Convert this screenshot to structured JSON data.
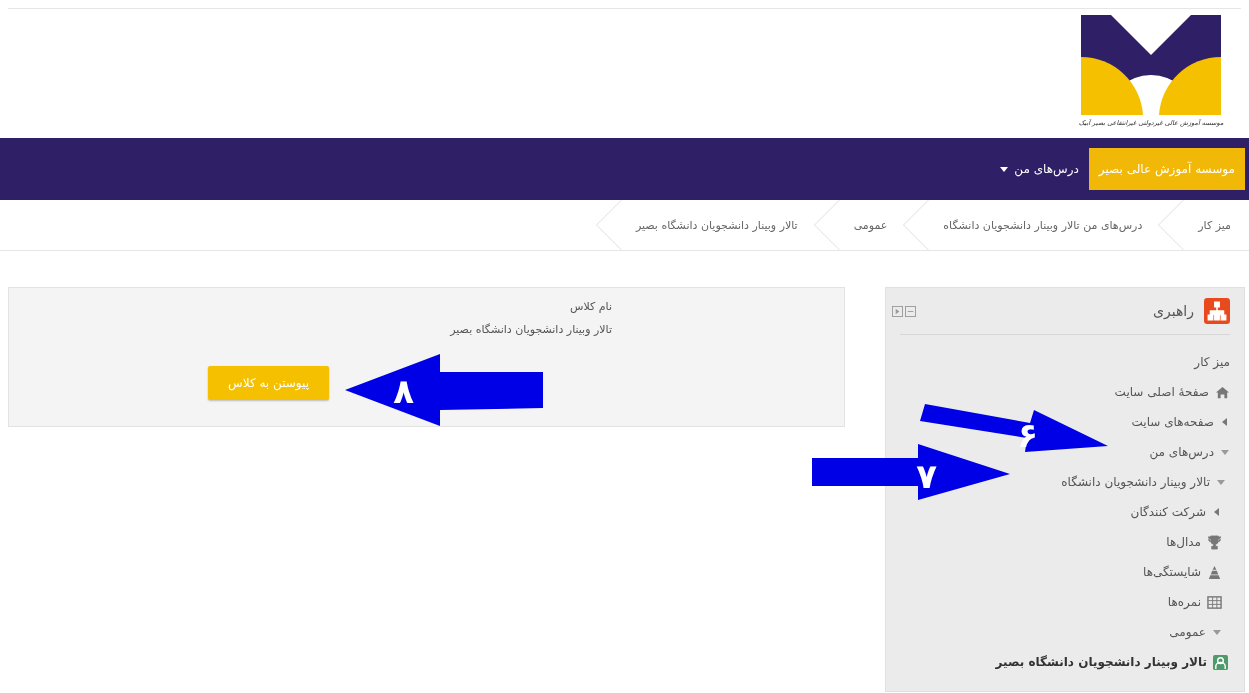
{
  "logo": {
    "caption": "موسسه آموزش عالی غیردولتی غیرانتفاعی بصیر آبیک"
  },
  "navbar": {
    "items": [
      {
        "label": "موسسه آموزش عالی بصیر",
        "selected": true,
        "dropdown": false
      },
      {
        "label": "درس‌های من",
        "selected": false,
        "dropdown": true
      }
    ]
  },
  "breadcrumb": [
    "میز کار",
    "درس‌های من تالار وبینار دانشجویان دانشگاه",
    "عمومی",
    "تالار وبینار دانشجویان دانشگاه بصیر"
  ],
  "navigation_block": {
    "title": "راهبری",
    "tree": [
      {
        "label": "میز کار",
        "kind": "text"
      },
      {
        "label": "صفحهٔ اصلی سایت",
        "kind": "home"
      },
      {
        "label": "صفحه‌های سایت",
        "kind": "branch",
        "expanded": false
      },
      {
        "label": "درس‌های من",
        "kind": "branch",
        "expanded": true,
        "children": [
          {
            "label": "تالار وبینار دانشجویان دانشگاه",
            "kind": "branch",
            "expanded": true,
            "children": [
              {
                "label": "شرکت کنندگان",
                "kind": "branch",
                "expanded": false
              },
              {
                "label": "مدال‌ها",
                "kind": "trophy"
              },
              {
                "label": "شایستگی‌ها",
                "kind": "competency"
              },
              {
                "label": "نمره‌ها",
                "kind": "grades"
              },
              {
                "label": "عمومی",
                "kind": "branch",
                "expanded": true,
                "children": [
                  {
                    "label": "تالار وبینار دانشجویان دانشگاه بصیر",
                    "kind": "activity"
                  }
                ]
              }
            ]
          }
        ]
      }
    ]
  },
  "class_panel": {
    "heading": "نام کلاس",
    "name": "تالار وبینار دانشجویان دانشگاه بصیر",
    "button": "پیوستن به کلاس"
  },
  "annotations": [
    {
      "label": "۸"
    },
    {
      "label": "۶"
    },
    {
      "label": "۷"
    }
  ]
}
